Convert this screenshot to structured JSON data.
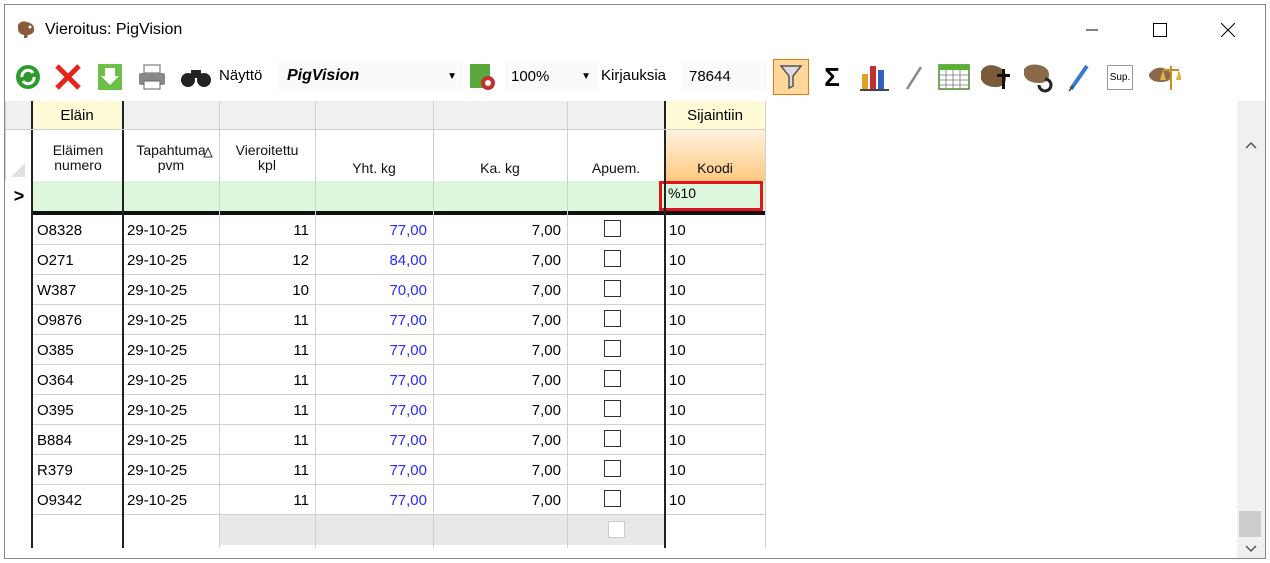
{
  "window": {
    "title": "Vieroitus: PigVision"
  },
  "toolbar": {
    "naytto_label": "Näyttö",
    "naytto_value": "PigVision",
    "zoom_value": "100%",
    "kirjauksia_label": "Kirjauksia",
    "kirjauksia_value": "78644",
    "sup_label": "Sup."
  },
  "grid": {
    "group_headers": {
      "elain": "Eläin",
      "sijaintiin": "Sijaintiin"
    },
    "columns": {
      "elaimen_numero": [
        "Eläimen",
        "numero"
      ],
      "tapahtuma_pvm": [
        "Tapahtuma",
        "pvm"
      ],
      "vieroitettu_kpl": [
        "Vieroitettu",
        "kpl"
      ],
      "yht_kg": "Yht. kg",
      "ka_kg": "Ka. kg",
      "apuem": "Apuem.",
      "koodi": "Koodi"
    },
    "current_row_marker": ">",
    "filter_row": {
      "koodi": "%10"
    },
    "rows": [
      {
        "numero": "O8328",
        "pvm": "29-10-25",
        "kpl": "11",
        "yht": "77,00",
        "ka": "7,00",
        "koodi": "10"
      },
      {
        "numero": "O271",
        "pvm": "29-10-25",
        "kpl": "12",
        "yht": "84,00",
        "ka": "7,00",
        "koodi": "10"
      },
      {
        "numero": "W387",
        "pvm": "29-10-25",
        "kpl": "10",
        "yht": "70,00",
        "ka": "7,00",
        "koodi": "10"
      },
      {
        "numero": "O9876",
        "pvm": "29-10-25",
        "kpl": "11",
        "yht": "77,00",
        "ka": "7,00",
        "koodi": "10"
      },
      {
        "numero": "O385",
        "pvm": "29-10-25",
        "kpl": "11",
        "yht": "77,00",
        "ka": "7,00",
        "koodi": "10"
      },
      {
        "numero": "O364",
        "pvm": "29-10-25",
        "kpl": "11",
        "yht": "77,00",
        "ka": "7,00",
        "koodi": "10"
      },
      {
        "numero": "O395",
        "pvm": "29-10-25",
        "kpl": "11",
        "yht": "77,00",
        "ka": "7,00",
        "koodi": "10"
      },
      {
        "numero": "B884",
        "pvm": "29-10-25",
        "kpl": "11",
        "yht": "77,00",
        "ka": "7,00",
        "koodi": "10"
      },
      {
        "numero": "R379",
        "pvm": "29-10-25",
        "kpl": "11",
        "yht": "77,00",
        "ka": "7,00",
        "koodi": "10"
      },
      {
        "numero": "O9342",
        "pvm": "29-10-25",
        "kpl": "11",
        "yht": "77,00",
        "ka": "7,00",
        "koodi": "10"
      }
    ]
  },
  "colors": {
    "filter_row_bg": "#dcf7dc",
    "group_header_bg": "#fffbd6",
    "koodi_header_bg": "#ffd9a0",
    "highlight_border": "#e0141e",
    "value_blue": "#2a2aff"
  }
}
